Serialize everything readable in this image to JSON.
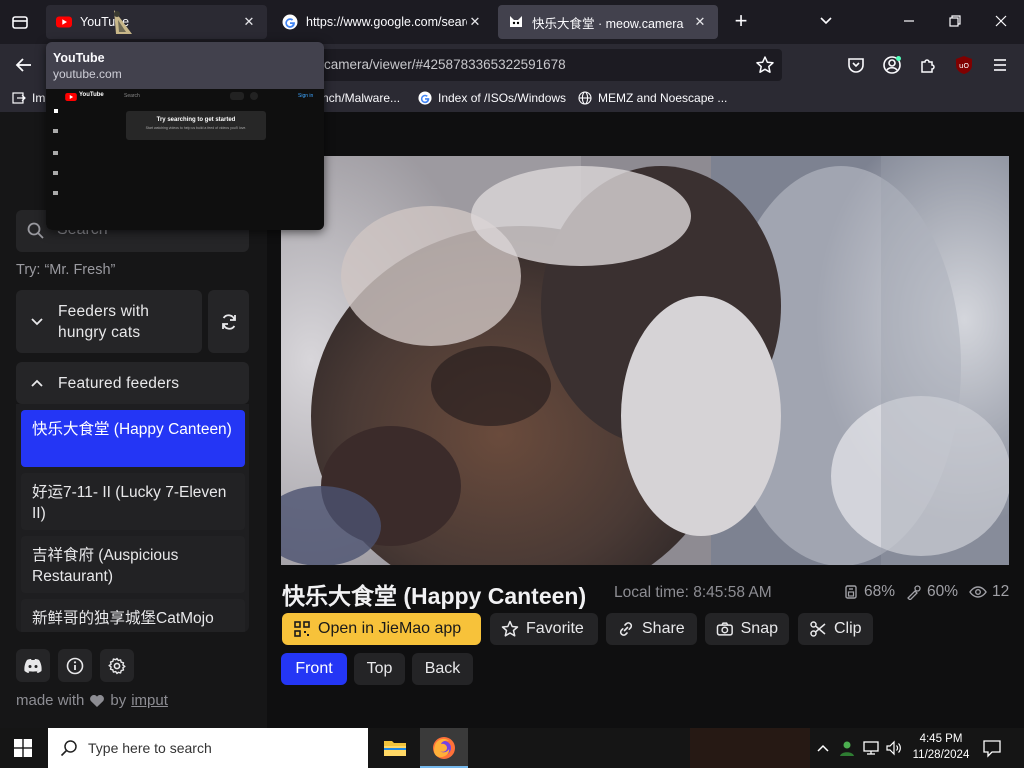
{
  "browser": {
    "tabs": [
      {
        "title": "YouTube",
        "favicon": "youtube-icon"
      },
      {
        "title": "https://www.google.com/search",
        "favicon": "google-icon"
      },
      {
        "title": "快乐大食堂 · meow.camera",
        "favicon": "cat-icon"
      }
    ],
    "url": "camera/viewer/#4258783365322591678",
    "bookmarks": [
      {
        "label": "Im",
        "icon": "import-icon"
      },
      {
        "label": "nch/Malware...",
        "icon": "folder-icon"
      },
      {
        "label": "Index of /ISOs/Windows",
        "icon": "google-icon"
      },
      {
        "label": "MEMZ and Noescape ...",
        "icon": "globe-icon"
      }
    ],
    "tab_preview": {
      "title": "YouTube",
      "url": "youtube.com",
      "thumb_heading": "Try searching to get started",
      "thumb_sub": "Start watching videos to help us build a feed of videos you'll love.",
      "thumb_brand": "YouTube",
      "thumb_search": "Search",
      "thumb_signin": "Sign in"
    }
  },
  "sidebar": {
    "search_placeholder": "Search",
    "search_hint": "Try: “Mr. Fresh”",
    "hungry_label": "Feeders with hungry cats",
    "featured_label": "Featured feeders",
    "feeders": [
      {
        "name": "快乐大食堂 (Happy Canteen)",
        "active": true
      },
      {
        "name": "好运7-11- II (Lucky 7-Eleven II)",
        "active": false
      },
      {
        "name": "吉祥食府 (Auspicious Restaurant)",
        "active": false
      },
      {
        "name": "新鲜哥的独享城堡CatMojo",
        "active": false
      }
    ],
    "footer_text": "made with",
    "footer_by": "by",
    "footer_link": "imput"
  },
  "viewer": {
    "title": "快乐大食堂 (Happy Canteen)",
    "local_time": "Local time: 8:45:58 AM",
    "food_level": "68%",
    "battery_level": "60%",
    "viewers": "12",
    "actions": {
      "open_app": "Open in JieMao app",
      "favorite": "Favorite",
      "share": "Share",
      "snap": "Snap",
      "clip": "Clip"
    },
    "cameras": [
      "Front",
      "Top",
      "Back"
    ]
  },
  "taskbar": {
    "search_placeholder": "Type here to search",
    "time": "4:45 PM",
    "date": "11/28/2024"
  },
  "colors": {
    "accent_blue": "#2436f5",
    "open_app_yellow": "#f7c23a",
    "firefox_tab": "#42414d"
  }
}
